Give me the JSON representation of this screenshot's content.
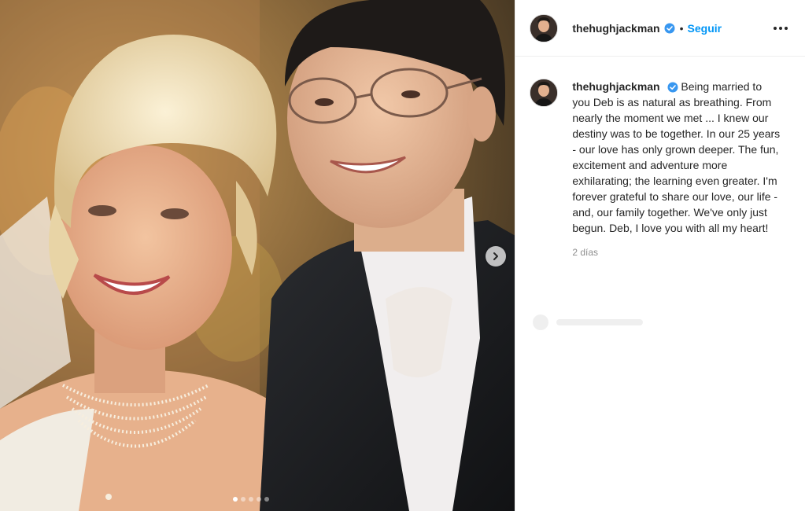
{
  "post": {
    "media": {
      "carousel_count": 5,
      "active_index": 1,
      "next_icon": "chevron-right-icon"
    },
    "header": {
      "username": "thehughjackman",
      "verified": true,
      "separator": "•",
      "follow_label": "Seguir",
      "more_icon": "ellipsis-icon"
    },
    "caption": {
      "username": "thehughjackman",
      "text": "Being married to you Deb is as natural as breathing. From nearly the moment we met ... I knew our destiny was to be together. In our 25 years - our love has only grown deeper. The fun, excitement and adventure more exhilarating; the learning even greater. I'm forever grateful to share our love, our life - and, our family together. We've only just begun. Deb, I love you with all my heart!",
      "timestamp": "2 días"
    },
    "colors": {
      "link_blue": "#0095f6",
      "verified_blue": "#3897f0",
      "muted_gray": "#8e8e8e"
    }
  }
}
